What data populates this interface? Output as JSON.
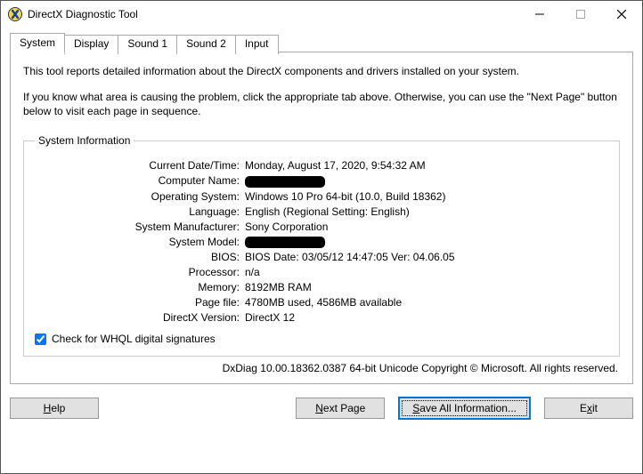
{
  "window": {
    "title": "DirectX Diagnostic Tool"
  },
  "tabs": {
    "system": "System",
    "display": "Display",
    "sound1": "Sound 1",
    "sound2": "Sound 2",
    "input": "Input"
  },
  "intro": {
    "line1": "This tool reports detailed information about the DirectX components and drivers installed on your system.",
    "line2": "If you know what area is causing the problem, click the appropriate tab above.  Otherwise, you can use the \"Next Page\" button below to visit each page in sequence."
  },
  "sysinfo": {
    "legend": "System Information",
    "labels": {
      "datetime": "Current Date/Time:",
      "computer_name": "Computer Name:",
      "os": "Operating System:",
      "language": "Language:",
      "manufacturer": "System Manufacturer:",
      "model": "System Model:",
      "bios": "BIOS:",
      "processor": "Processor:",
      "memory": "Memory:",
      "pagefile": "Page file:",
      "directx": "DirectX Version:"
    },
    "values": {
      "datetime": "Monday, August 17, 2020, 9:54:32 AM",
      "computer_name": "",
      "os": "Windows 10 Pro 64-bit (10.0, Build 18362)",
      "language": "English (Regional Setting: English)",
      "manufacturer": "Sony Corporation",
      "model": "",
      "bios": "BIOS Date: 03/05/12 14:47:05 Ver: 04.06.05",
      "processor": "n/a",
      "memory": "8192MB RAM",
      "pagefile": "4780MB used, 4586MB available",
      "directx": "DirectX 12"
    },
    "whql_label": "Check for WHQL digital signatures",
    "whql_checked": true
  },
  "footer": "DxDiag 10.00.18362.0387 64-bit Unicode  Copyright © Microsoft. All rights reserved.",
  "buttons": {
    "help": "Help",
    "next_page": "Next Page",
    "save_all": "Save All Information...",
    "exit": "Exit"
  }
}
